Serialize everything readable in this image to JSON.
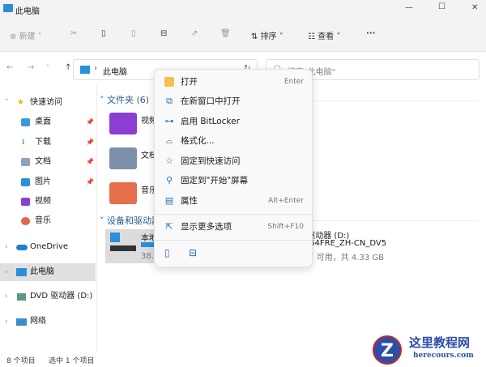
{
  "window": {
    "title": "此电脑",
    "minimize": "—",
    "maximize": "☐",
    "close": "✕"
  },
  "toolbar": {
    "new": "新建",
    "sort": "排序",
    "view": "查看",
    "more": "···"
  },
  "address": {
    "path": "此电脑",
    "search_placeholder": "搜索\"此电脑\""
  },
  "sidebar": {
    "items": [
      {
        "label": "快速访问"
      },
      {
        "label": "桌面"
      },
      {
        "label": "下载"
      },
      {
        "label": "文档"
      },
      {
        "label": "图片"
      },
      {
        "label": "视频"
      },
      {
        "label": "音乐"
      },
      {
        "label": "OneDrive"
      },
      {
        "label": "此电脑"
      },
      {
        "label": "DVD 驱动器 (D:) CI"
      },
      {
        "label": "网络"
      }
    ]
  },
  "main": {
    "folders_header": "文件夹 (6)",
    "devices_header": "设备和驱动器",
    "folders": [
      {
        "label": "视频"
      },
      {
        "label": "文档"
      },
      {
        "label": "音乐"
      }
    ],
    "drive_c": {
      "name": "本地磁盘 (C:)",
      "free": "38.7"
    },
    "drive_d": {
      "name": "DVD 驱动器 (D:)",
      "label": "CCCOMA_X64FRE_ZH-CN_DV5",
      "space": "0 字节 可用，共 4.33 GB"
    }
  },
  "context_menu": {
    "items": [
      {
        "label": "打开",
        "shortcut": "Enter"
      },
      {
        "label": "在新窗口中打开"
      },
      {
        "label": "启用 BitLocker"
      },
      {
        "label": "格式化..."
      },
      {
        "label": "固定到快速访问"
      },
      {
        "label": "固定到\"开始\"屏幕"
      },
      {
        "label": "属性",
        "shortcut": "Alt+Enter"
      },
      {
        "label": "显示更多选项",
        "shortcut": "Shift+F10"
      }
    ]
  },
  "status": {
    "count": "8 个项目",
    "selected": "选中 1 个项目"
  },
  "watermark": {
    "title": "这里教程网",
    "url": "herecours.com"
  }
}
